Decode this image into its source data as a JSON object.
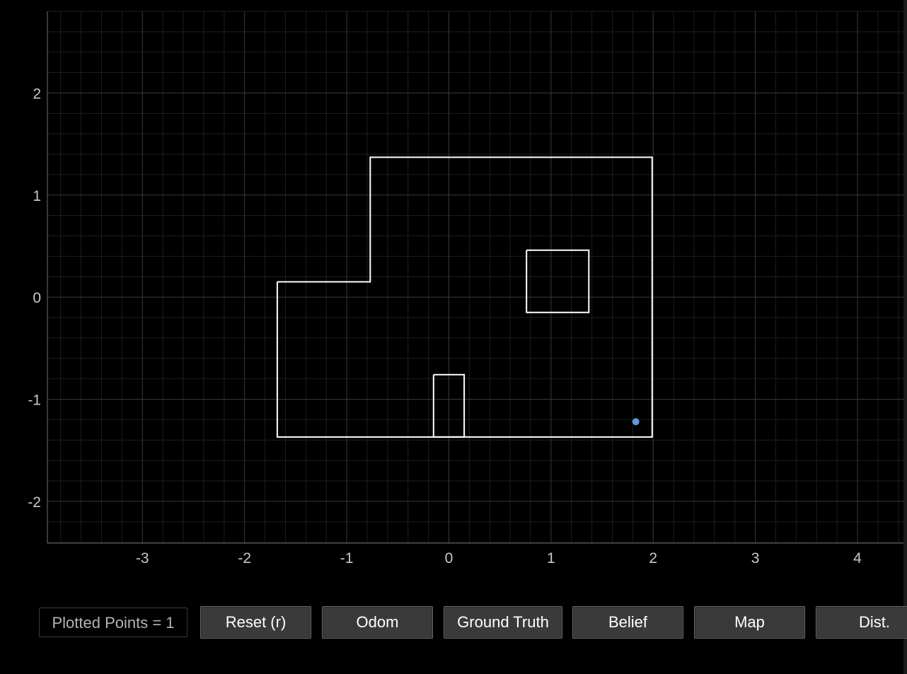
{
  "plot": {
    "x_ticks": [
      "-3",
      "-2",
      "-1",
      "0",
      "1",
      "2",
      "3",
      "4"
    ],
    "y_ticks": [
      "2",
      "1",
      "0",
      "-1",
      "-2"
    ],
    "xlim": [
      -3.93,
      4.45
    ],
    "ylim": [
      -2.41,
      2.8
    ],
    "minor_step": 0.2,
    "colors": {
      "background": "#000000",
      "major_grid": "#3a3a3a",
      "minor_grid": "#1e1e1e",
      "axis": "#6e6e6e",
      "map": "#ffffff",
      "point": "#5b9bd5"
    },
    "map_polylines": [
      [
        [
          -1.68,
          0.15
        ],
        [
          -0.77,
          0.15
        ],
        [
          -0.77,
          1.37
        ],
        [
          1.99,
          1.37
        ],
        [
          1.99,
          -1.37
        ],
        [
          -1.68,
          -1.37
        ],
        [
          -1.68,
          0.15
        ]
      ],
      [
        [
          0.76,
          0.46
        ],
        [
          1.37,
          0.46
        ],
        [
          1.37,
          -0.15
        ],
        [
          0.76,
          -0.15
        ],
        [
          0.76,
          0.46
        ]
      ],
      [
        [
          -0.15,
          -0.76
        ],
        [
          0.15,
          -0.76
        ],
        [
          0.15,
          -1.37
        ],
        [
          -0.15,
          -1.37
        ],
        [
          -0.15,
          -0.76
        ]
      ]
    ],
    "points": [
      {
        "x": 1.83,
        "y": -1.22
      }
    ]
  },
  "toolbar": {
    "status": "Plotted Points = 1",
    "reset_label": "Reset (r)",
    "odom_label": "Odom",
    "ground_truth_label": "Ground Truth",
    "belief_label": "Belief",
    "map_label": "Map",
    "dist_label": "Dist."
  }
}
